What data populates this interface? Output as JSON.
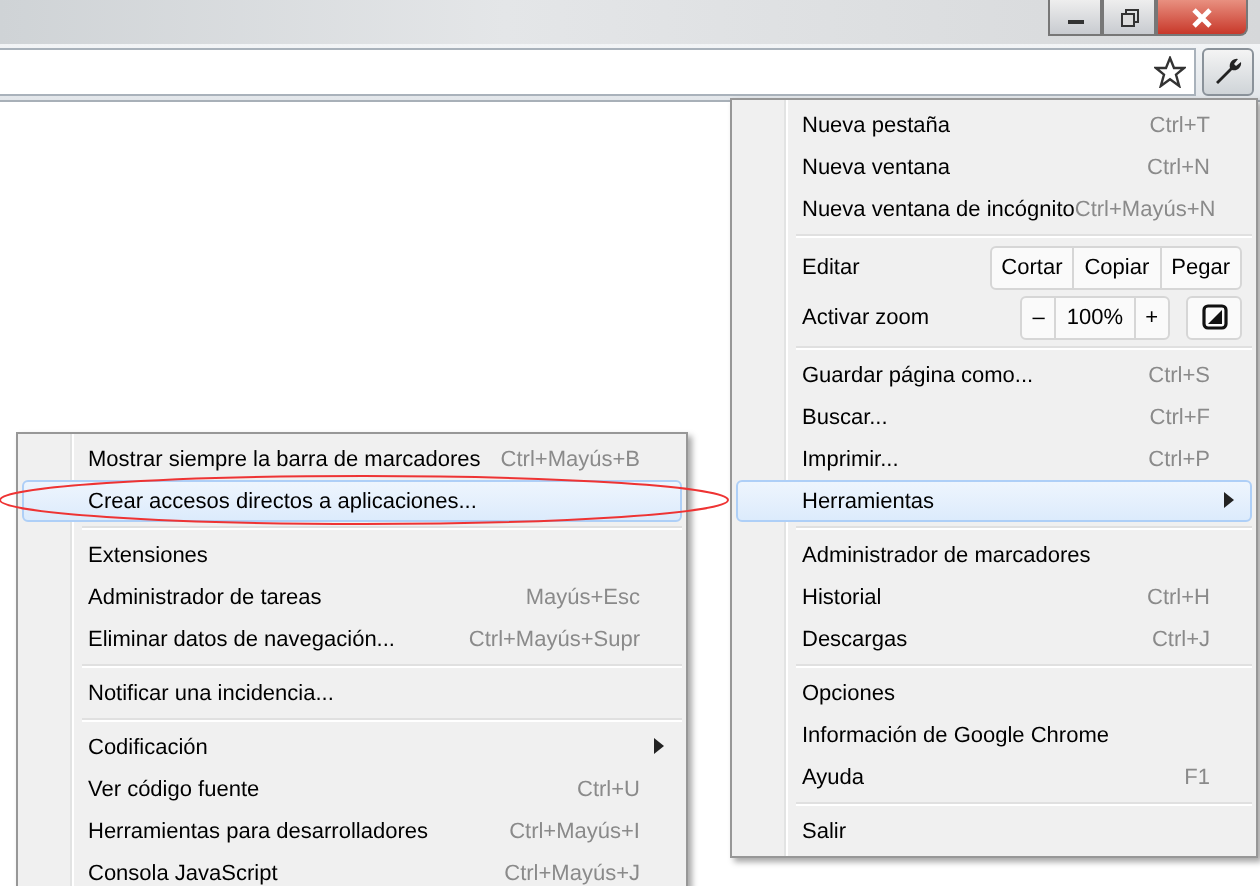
{
  "main_menu": {
    "items": [
      {
        "kind": "item",
        "label": "Nueva pestaña",
        "shortcut": "Ctrl+T",
        "selected": false,
        "submenu": false
      },
      {
        "kind": "item",
        "label": "Nueva ventana",
        "shortcut": "Ctrl+N",
        "selected": false,
        "submenu": false
      },
      {
        "kind": "item",
        "label": "Nueva ventana de incógnito",
        "shortcut": "Ctrl+Mayús+N",
        "selected": false,
        "submenu": false
      },
      {
        "kind": "separator"
      },
      {
        "kind": "buttons",
        "label": "Editar",
        "buttons": [
          "Cortar",
          "Copiar",
          "Pegar"
        ]
      },
      {
        "kind": "zoom",
        "label": "Activar zoom",
        "buttons": [
          "–",
          "100%",
          "+"
        ]
      },
      {
        "kind": "separator"
      },
      {
        "kind": "item",
        "label": "Guardar página como...",
        "shortcut": "Ctrl+S",
        "selected": false,
        "submenu": false
      },
      {
        "kind": "item",
        "label": "Buscar...",
        "shortcut": "Ctrl+F",
        "selected": false,
        "submenu": false
      },
      {
        "kind": "item",
        "label": "Imprimir...",
        "shortcut": "Ctrl+P",
        "selected": false,
        "submenu": false
      },
      {
        "kind": "item",
        "label": "Herramientas",
        "selected": true,
        "submenu": true
      },
      {
        "kind": "separator"
      },
      {
        "kind": "item",
        "label": "Administrador de marcadores",
        "selected": false,
        "submenu": false
      },
      {
        "kind": "item",
        "label": "Historial",
        "shortcut": "Ctrl+H",
        "selected": false,
        "submenu": false
      },
      {
        "kind": "item",
        "label": "Descargas",
        "shortcut": "Ctrl+J",
        "selected": false,
        "submenu": false
      },
      {
        "kind": "separator"
      },
      {
        "kind": "item",
        "label": "Opciones",
        "selected": false,
        "submenu": false
      },
      {
        "kind": "item",
        "label": "Información de Google Chrome",
        "selected": false,
        "submenu": false
      },
      {
        "kind": "item",
        "label": "Ayuda",
        "shortcut": "F1",
        "selected": false,
        "submenu": false
      },
      {
        "kind": "separator"
      },
      {
        "kind": "item",
        "label": "Salir",
        "selected": false,
        "submenu": false
      }
    ]
  },
  "submenu": {
    "items": [
      {
        "kind": "item",
        "label": "Mostrar siempre la barra de marcadores",
        "shortcut": "Ctrl+Mayús+B",
        "selected": false,
        "submenu": false
      },
      {
        "kind": "item",
        "label": "Crear accesos directos a aplicaciones...",
        "selected": true,
        "submenu": false,
        "circled": true
      },
      {
        "kind": "separator"
      },
      {
        "kind": "item",
        "label": "Extensiones",
        "selected": false,
        "submenu": false
      },
      {
        "kind": "item",
        "label": "Administrador de tareas",
        "shortcut": "Mayús+Esc",
        "selected": false,
        "submenu": false
      },
      {
        "kind": "item",
        "label": "Eliminar datos de navegación...",
        "shortcut": "Ctrl+Mayús+Supr",
        "selected": false,
        "submenu": false
      },
      {
        "kind": "separator"
      },
      {
        "kind": "item",
        "label": "Notificar una incidencia...",
        "selected": false,
        "submenu": false
      },
      {
        "kind": "separator"
      },
      {
        "kind": "item",
        "label": "Codificación",
        "selected": false,
        "submenu": true
      },
      {
        "kind": "item",
        "label": "Ver código fuente",
        "shortcut": "Ctrl+U",
        "selected": false,
        "submenu": false
      },
      {
        "kind": "item",
        "label": "Herramientas para desarrolladores",
        "shortcut": "Ctrl+Mayús+I",
        "selected": false,
        "submenu": false
      },
      {
        "kind": "item",
        "label": "Consola JavaScript",
        "shortcut": "Ctrl+Mayús+J",
        "selected": false,
        "submenu": false
      }
    ]
  }
}
